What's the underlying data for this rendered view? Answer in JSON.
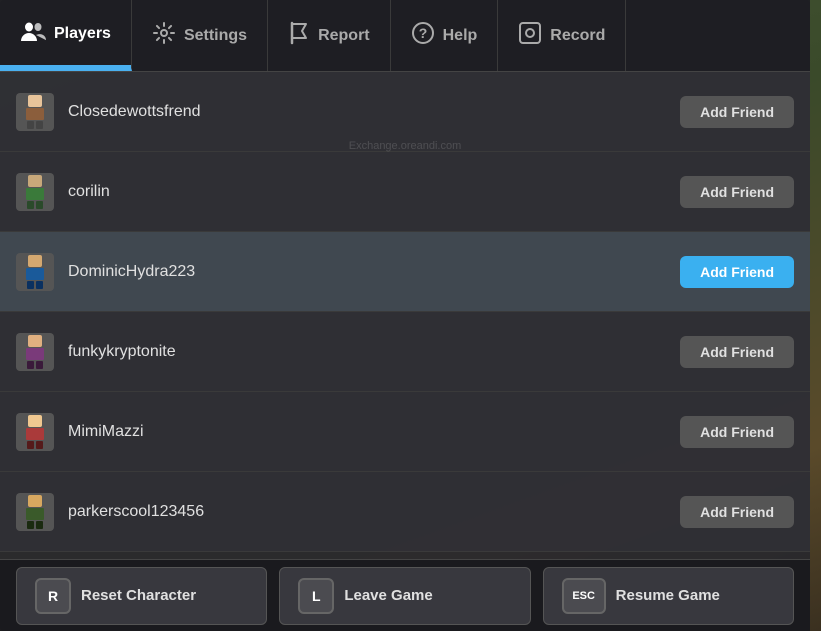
{
  "nav": {
    "items": [
      {
        "id": "players",
        "label": "Players",
        "icon": "👥",
        "active": true
      },
      {
        "id": "settings",
        "label": "Settings",
        "icon": "⚙️",
        "active": false
      },
      {
        "id": "report",
        "label": "Report",
        "icon": "🚩",
        "active": false
      },
      {
        "id": "help",
        "label": "Help",
        "icon": "❓",
        "active": false
      },
      {
        "id": "record",
        "label": "Record",
        "icon": "⊙",
        "active": false
      }
    ]
  },
  "players": [
    {
      "id": "p1",
      "name": "Closedewottsfrend",
      "add_friend": "Add Friend",
      "highlighted": false,
      "selected": false
    },
    {
      "id": "p2",
      "name": "corilin",
      "add_friend": "Add Friend",
      "highlighted": false,
      "selected": false
    },
    {
      "id": "p3",
      "name": "DominicHydra223",
      "add_friend": "Add Friend",
      "highlighted": true,
      "selected": true
    },
    {
      "id": "p4",
      "name": "funkykryptonite",
      "add_friend": "Add Friend",
      "highlighted": false,
      "selected": false
    },
    {
      "id": "p5",
      "name": "MimiMazzi",
      "add_friend": "Add Friend",
      "highlighted": false,
      "selected": false
    },
    {
      "id": "p6",
      "name": "parkerscool123456",
      "add_friend": "Add Friend",
      "highlighted": false,
      "selected": false
    }
  ],
  "actions": [
    {
      "id": "reset",
      "key": "R",
      "label": "Reset Character"
    },
    {
      "id": "leave",
      "key": "L",
      "label": "Leave Game"
    },
    {
      "id": "resume",
      "key": "ESC",
      "label": "Resume Game"
    }
  ],
  "watermark": "Exchange.oreandi.com"
}
